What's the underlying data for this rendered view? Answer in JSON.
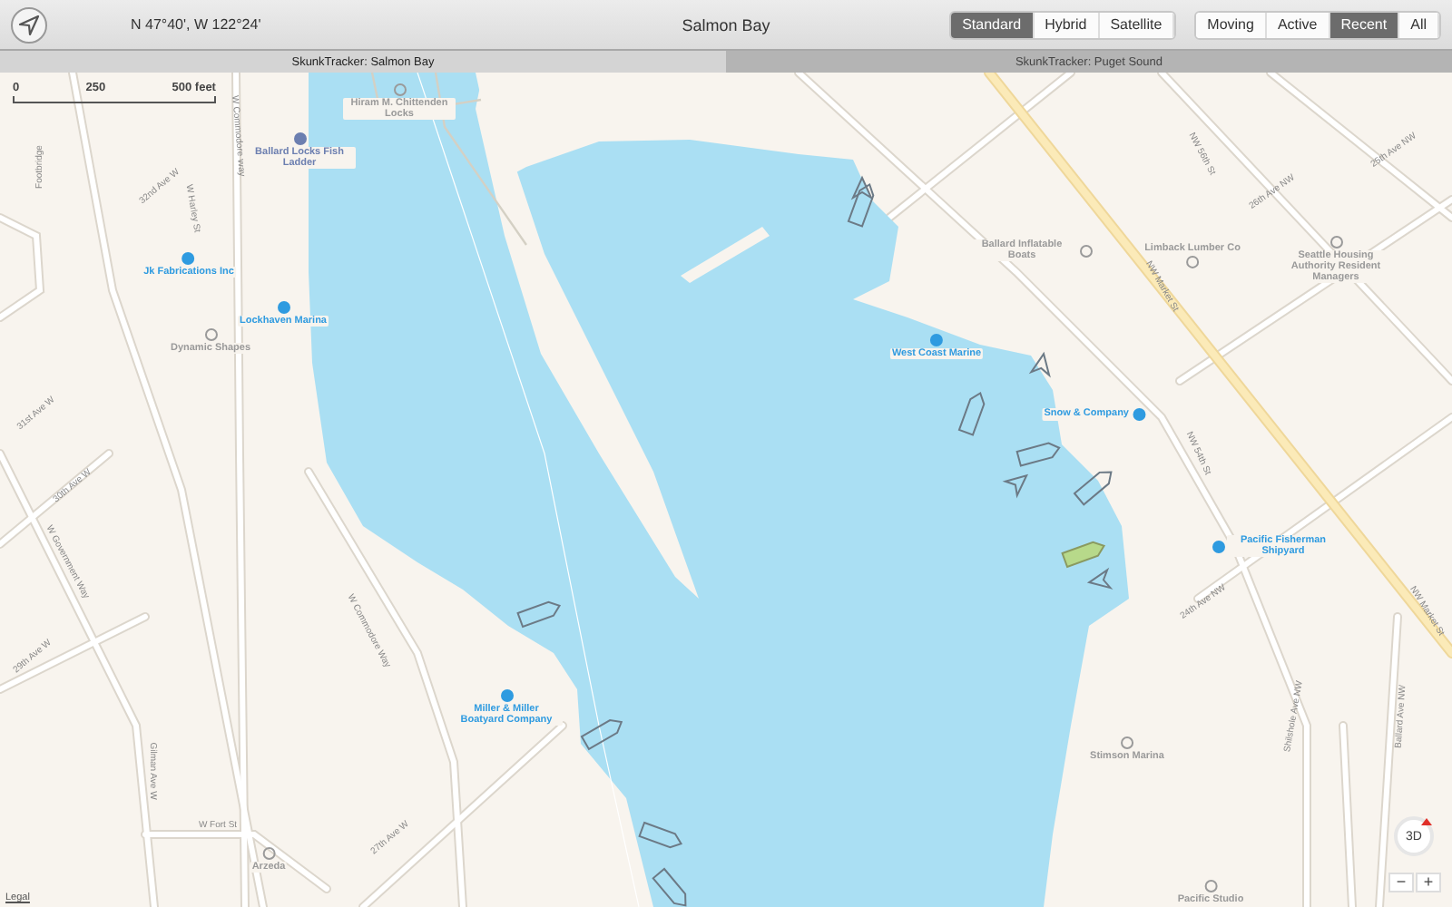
{
  "toolbar": {
    "coordinates": "N 47°40', W 122°24'",
    "title": "Salmon Bay",
    "map_types": [
      {
        "label": "Standard",
        "selected": true
      },
      {
        "label": "Hybrid",
        "selected": false
      },
      {
        "label": "Satellite",
        "selected": false
      }
    ],
    "filters": [
      {
        "label": "Moving",
        "selected": false
      },
      {
        "label": "Active",
        "selected": false
      },
      {
        "label": "Recent",
        "selected": true
      },
      {
        "label": "All",
        "selected": false
      }
    ]
  },
  "tabs": [
    {
      "label": "SkunkTracker: Salmon Bay",
      "selected": true
    },
    {
      "label": "SkunkTracker: Puget Sound",
      "selected": false
    }
  ],
  "map": {
    "scale": [
      "0",
      "250",
      "500 feet"
    ],
    "places": [
      {
        "name": "Hiram M. Chittenden Locks",
        "kind": "place"
      },
      {
        "name": "Ballard Locks Fish Ladder",
        "kind": "landmark"
      },
      {
        "name": "Jk Fabrications Inc",
        "kind": "business"
      },
      {
        "name": "Lockhaven Marina",
        "kind": "business"
      },
      {
        "name": "Dynamic Shapes",
        "kind": "place"
      },
      {
        "name": "West Coast Marine",
        "kind": "business"
      },
      {
        "name": "Snow & Company",
        "kind": "business"
      },
      {
        "name": "Ballard Inflatable Boats",
        "kind": "place"
      },
      {
        "name": "Limback Lumber Co",
        "kind": "place"
      },
      {
        "name": "Seattle Housing Authority Resident Managers",
        "kind": "place"
      },
      {
        "name": "Pacific Fisherman Shipyard",
        "kind": "business"
      },
      {
        "name": "Miller & Miller Boatyard Company",
        "kind": "business"
      },
      {
        "name": "Stimson Marina",
        "kind": "place"
      },
      {
        "name": "Arzeda",
        "kind": "place"
      },
      {
        "name": "Pacific Studio",
        "kind": "place"
      }
    ],
    "streets": [
      {
        "name": "Footbridge"
      },
      {
        "name": "32nd Ave W"
      },
      {
        "name": "W Harley St"
      },
      {
        "name": "W Commodore Way"
      },
      {
        "name": "31st Ave W"
      },
      {
        "name": "30th Ave W"
      },
      {
        "name": "W Government Way"
      },
      {
        "name": "29th Ave W"
      },
      {
        "name": "Gilman Ave W"
      },
      {
        "name": "W Fort St"
      },
      {
        "name": "W Commodore Way"
      },
      {
        "name": "27th Ave W"
      },
      {
        "name": "NW Market St"
      },
      {
        "name": "NW 56th St"
      },
      {
        "name": "26th Ave NW"
      },
      {
        "name": "25th Ave NW"
      },
      {
        "name": "NW 54th St"
      },
      {
        "name": "24th Ave NW"
      },
      {
        "name": "Shilshole Ave NW"
      },
      {
        "name": "Ballard Ave NW"
      },
      {
        "name": "NW Market St"
      }
    ],
    "vessels": [
      {
        "kind": "boat",
        "selected": false
      },
      {
        "kind": "heading",
        "selected": false
      },
      {
        "kind": "boat",
        "selected": false
      },
      {
        "kind": "heading",
        "selected": false
      },
      {
        "kind": "boat",
        "selected": false
      },
      {
        "kind": "heading",
        "selected": false
      },
      {
        "kind": "boat",
        "selected": false
      },
      {
        "kind": "boat",
        "selected": true
      },
      {
        "kind": "heading",
        "selected": false
      },
      {
        "kind": "boat",
        "selected": false
      },
      {
        "kind": "boat",
        "selected": false
      },
      {
        "kind": "boat",
        "selected": false
      },
      {
        "kind": "boat",
        "selected": false
      }
    ],
    "view_button": "3D",
    "zoom_out": "−",
    "zoom_in": "+",
    "legal": "Legal"
  }
}
